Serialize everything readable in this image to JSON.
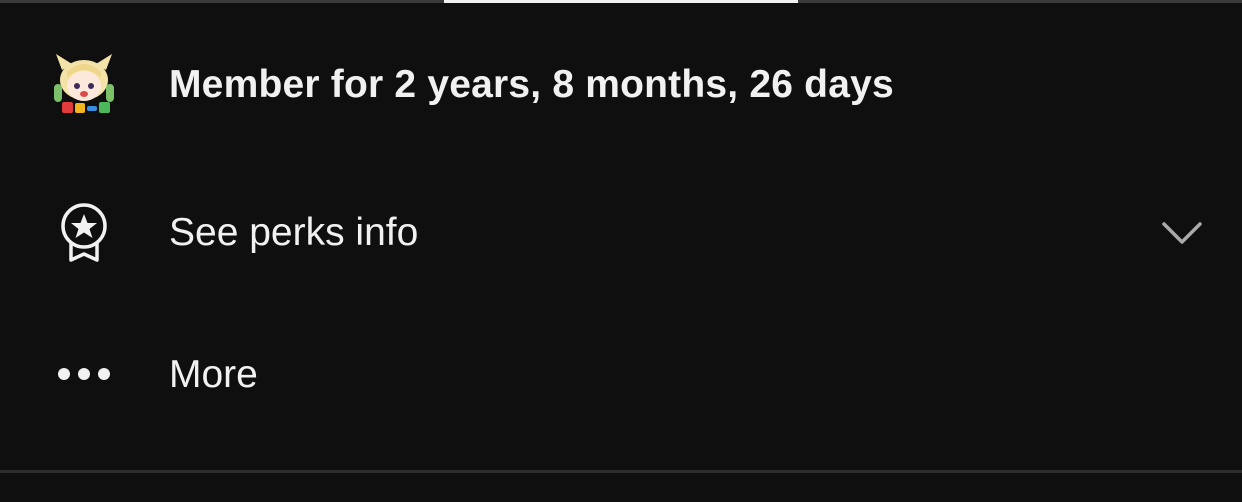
{
  "membership": {
    "duration_label": "Member for 2 years, 8 months, 26 days",
    "badge_icon": "member-badge-avatar"
  },
  "perks": {
    "label": "See perks info",
    "icon": "award-ribbon-star-icon",
    "expand_icon": "chevron-down-icon"
  },
  "more": {
    "label": "More",
    "icon": "more-horizontal-icon"
  },
  "colors": {
    "background": "#0f0f0f",
    "text": "#f1f1f1",
    "divider": "#2c2c2c"
  }
}
